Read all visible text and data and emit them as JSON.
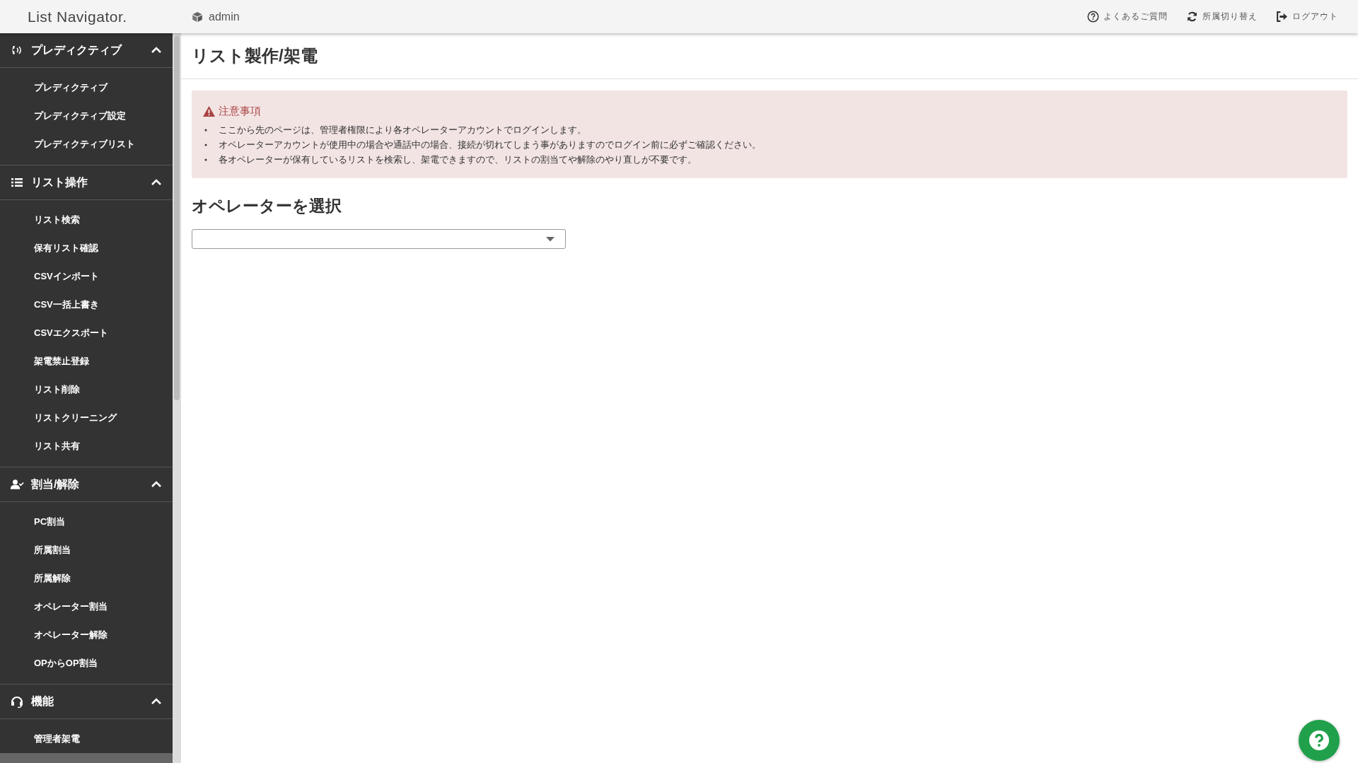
{
  "header": {
    "logo": "List Navigator.",
    "user": "admin",
    "links": [
      {
        "kind": "faq",
        "label": "よくあるご質問"
      },
      {
        "kind": "switch",
        "label": "所属切り替え"
      },
      {
        "kind": "logout",
        "label": "ログアウト"
      }
    ]
  },
  "sidebar": {
    "groups": [
      {
        "kind": "predictive",
        "label": "プレディクティブ",
        "expanded": true,
        "items": [
          {
            "label": "プレディクティブ",
            "selected": false
          },
          {
            "label": "プレディクティブ設定",
            "selected": false
          },
          {
            "label": "プレディクティブリスト",
            "selected": false
          }
        ]
      },
      {
        "kind": "list",
        "label": "リスト操作",
        "expanded": true,
        "items": [
          {
            "label": "リスト検索",
            "selected": false
          },
          {
            "label": "保有リスト確認",
            "selected": false
          },
          {
            "label": "CSVインポート",
            "selected": false
          },
          {
            "label": "CSV一括上書き",
            "selected": false
          },
          {
            "label": "CSVエクスポート",
            "selected": false
          },
          {
            "label": "架電禁止登録",
            "selected": false
          },
          {
            "label": "リスト削除",
            "selected": false
          },
          {
            "label": "リストクリーニング",
            "selected": false
          },
          {
            "label": "リスト共有",
            "selected": false
          }
        ]
      },
      {
        "kind": "assign",
        "label": "割当/解除",
        "expanded": true,
        "items": [
          {
            "label": "PC割当",
            "selected": false
          },
          {
            "label": "所属割当",
            "selected": false
          },
          {
            "label": "所属解除",
            "selected": false
          },
          {
            "label": "オペレーター割当",
            "selected": false
          },
          {
            "label": "オペレーター解除",
            "selected": false
          },
          {
            "label": "OPからOP割当",
            "selected": false
          }
        ]
      },
      {
        "kind": "function",
        "label": "機能",
        "expanded": true,
        "items": [
          {
            "label": "管理者架電",
            "selected": false
          },
          {
            "selected": true
          }
        ]
      }
    ]
  },
  "page": {
    "title": "リスト製作/架電",
    "notice": {
      "title": "注意事項",
      "items": [
        "ここから先のページは、管理者権限により各オペレーターアカウントでログインします。",
        "オペレーターアカウントが使用中の場合や通話中の場合、接続が切れてしまう事がありますのでログイン前に必ずご確認ください。",
        "各オペレーターが保有しているリストを検索し、架電できますので、リストの割当てや解除のやり直しが不要です。"
      ]
    },
    "section_title": "オペレーターを選択"
  }
}
